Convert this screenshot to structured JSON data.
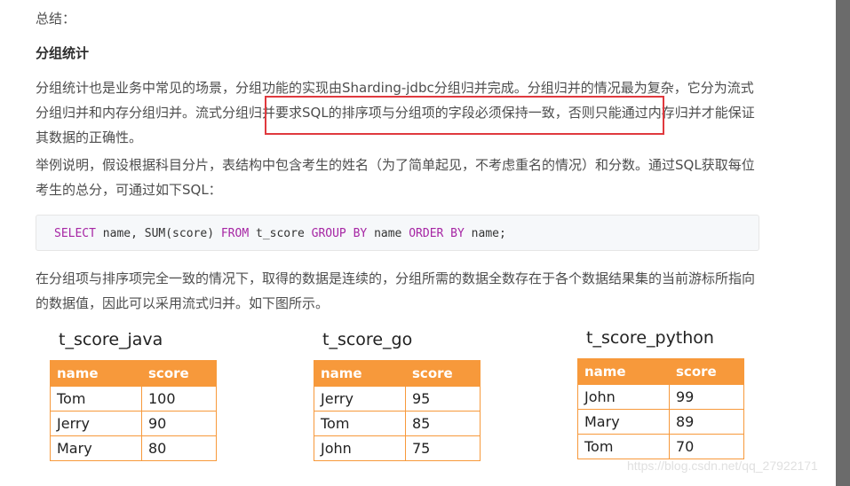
{
  "summary_label": "总结：",
  "section_heading": "分组统计",
  "paragraph1": {
    "text_a": "分组统计也是业务中常见的场景，分组功能的实现由Sharding-jdbc分组归并完成。分组归并的情况最为复杂，它分为流式分组归并和内存分组归并。",
    "highlight": "流式分组归并要求SQL的排序项与分组项的字段必须保持一致",
    "text_b": "，否则只能通过内存归并才能保证其数据的正确性。"
  },
  "paragraph2": "举例说明，假设根据科目分片，表结构中包含考生的姓名（为了简单起见，不考虑重名的情况）和分数。通过SQL获取每位考生的总分，可通过如下SQL：",
  "code": {
    "kw_select": "SELECT",
    "part1": " name, SUM(score) ",
    "kw_from": "FROM",
    "part2": " t_score ",
    "kw_group": "GROUP BY",
    "part3": " name ",
    "kw_order": "ORDER BY",
    "part4": " name;"
  },
  "paragraph3": "在分组项与排序项完全一致的情况下，取得的数据是连续的，分组所需的数据全数存在于各个数据结果集的当前游标所指向的数据值，因此可以采用流式归并。如下图所示。",
  "tables": [
    {
      "title": "t_score_java",
      "headers": [
        "name",
        "score"
      ],
      "rows": [
        [
          "Tom",
          "100"
        ],
        [
          "Jerry",
          "90"
        ],
        [
          "Mary",
          "80"
        ]
      ]
    },
    {
      "title": "t_score_go",
      "headers": [
        "name",
        "score"
      ],
      "rows": [
        [
          "Jerry",
          "95"
        ],
        [
          "Tom",
          "85"
        ],
        [
          "John",
          "75"
        ]
      ]
    },
    {
      "title": "t_score_python",
      "headers": [
        "name",
        "score"
      ],
      "rows": [
        [
          "John",
          "99"
        ],
        [
          "Mary",
          "89"
        ],
        [
          "Tom",
          "70"
        ]
      ]
    }
  ],
  "watermark": "https://blog.csdn.net/qq_27922171",
  "colors": {
    "table_header": "#f7993b",
    "highlight_border": "#e0393e",
    "code_keyword": "#a626a4"
  }
}
